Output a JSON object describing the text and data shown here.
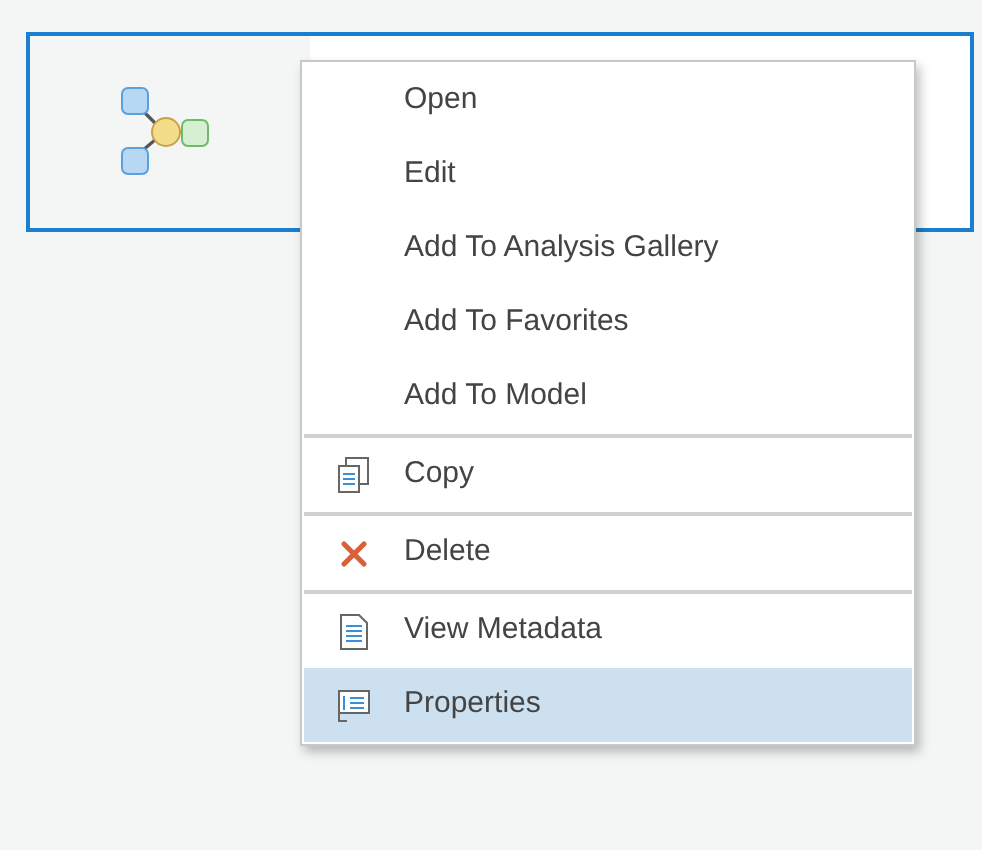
{
  "context_menu": {
    "groups": [
      {
        "items": [
          {
            "label": "Open",
            "kind": "plain",
            "selected": false
          },
          {
            "label": "Edit",
            "kind": "plain",
            "selected": false
          },
          {
            "label": "Add To Analysis Gallery",
            "kind": "plain",
            "selected": false
          },
          {
            "label": "Add To Favorites",
            "kind": "plain",
            "selected": false
          },
          {
            "label": "Add To Model",
            "kind": "plain",
            "selected": false
          }
        ]
      },
      {
        "items": [
          {
            "label": "Copy",
            "kind": "copy",
            "selected": false
          }
        ]
      },
      {
        "items": [
          {
            "label": "Delete",
            "kind": "delete",
            "selected": false
          }
        ]
      },
      {
        "items": [
          {
            "label": "View Metadata",
            "kind": "metadata",
            "selected": false
          },
          {
            "label": "Properties",
            "kind": "properties",
            "selected": true
          }
        ]
      }
    ]
  }
}
